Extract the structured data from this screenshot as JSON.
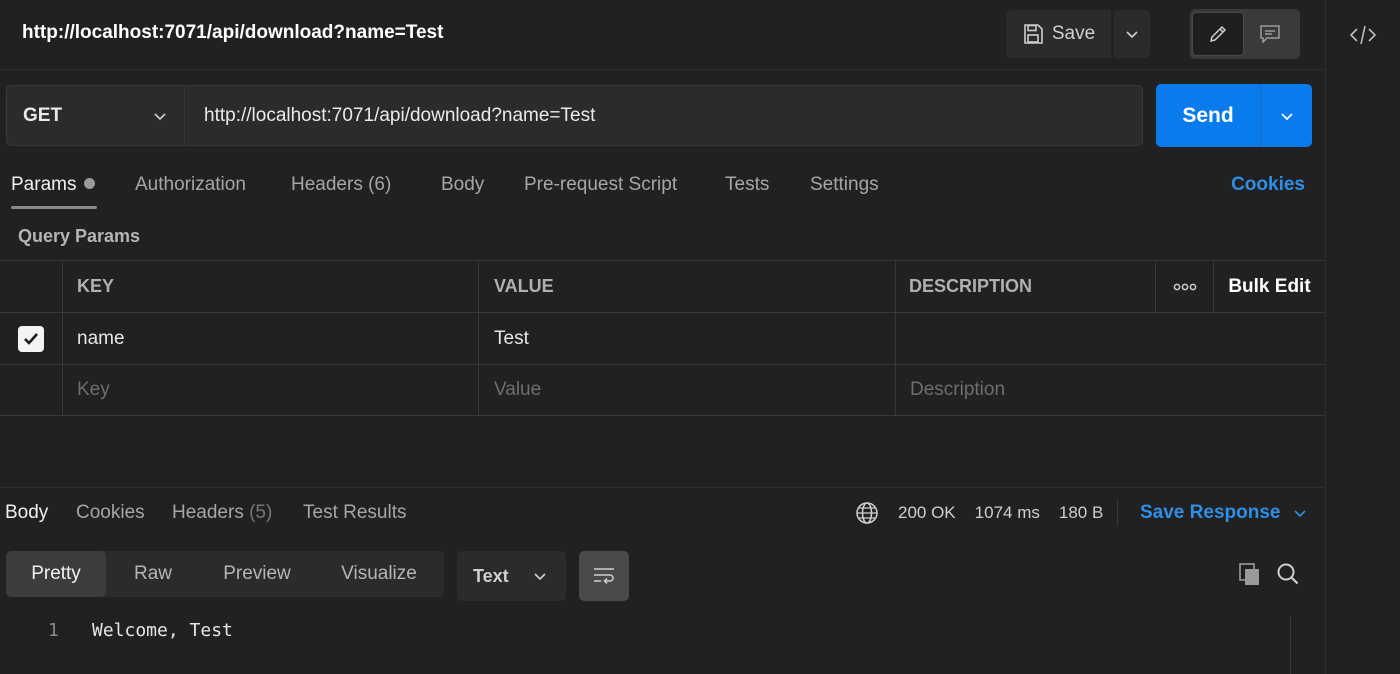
{
  "header": {
    "request_name": "http://localhost:7071/api/download?name=Test",
    "save_label": "Save"
  },
  "request": {
    "method": "GET",
    "url": "http://localhost:7071/api/download?name=Test",
    "send_label": "Send"
  },
  "request_tabs": [
    {
      "label": "Params"
    },
    {
      "label": "Authorization"
    },
    {
      "label": "Headers (6)"
    },
    {
      "label": "Body"
    },
    {
      "label": "Pre-request Script"
    },
    {
      "label": "Tests"
    },
    {
      "label": "Settings"
    }
  ],
  "cookies_link": "Cookies",
  "query_params": {
    "title": "Query Params",
    "columns": {
      "key": "KEY",
      "value": "VALUE",
      "description": "DESCRIPTION",
      "more": "ooo",
      "bulk_edit": "Bulk Edit"
    },
    "rows": [
      {
        "key": "name",
        "value": "Test",
        "description": "",
        "checked": true
      }
    ],
    "placeholders": {
      "key": "Key",
      "value": "Value",
      "description": "Description"
    }
  },
  "response": {
    "tabs": [
      {
        "label": "Body"
      },
      {
        "label": "Cookies"
      },
      {
        "label": "Headers",
        "count": "(5)"
      },
      {
        "label": "Test Results"
      }
    ],
    "status": "200 OK",
    "time": "1074 ms",
    "size": "180 B",
    "save_response_label": "Save Response",
    "view_modes": [
      "Pretty",
      "Raw",
      "Preview",
      "Visualize"
    ],
    "format": "Text",
    "lines": [
      {
        "num": "1",
        "text": "Welcome, Test"
      }
    ]
  },
  "colors": {
    "accent": "#097bed",
    "link": "#2f8ee6",
    "background": "#212121"
  }
}
